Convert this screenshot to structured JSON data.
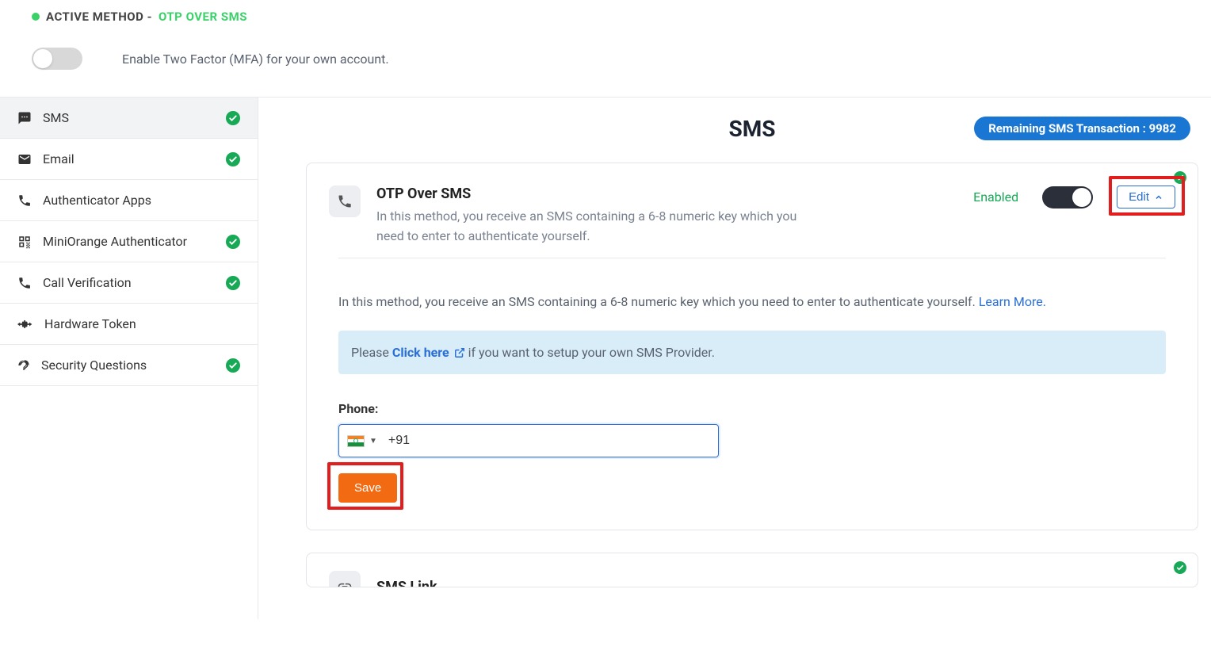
{
  "banner": {
    "activeLabel": "ACTIVE METHOD -",
    "activeValue": "OTP OVER SMS",
    "mfaDesc": "Enable Two Factor (MFA) for your own account."
  },
  "sidebar": {
    "items": [
      {
        "label": "SMS",
        "check": true,
        "active": true,
        "icon": "sms"
      },
      {
        "label": "Email",
        "check": true,
        "active": false,
        "icon": "email"
      },
      {
        "label": "Authenticator Apps",
        "check": false,
        "active": false,
        "icon": "phone"
      },
      {
        "label": "MiniOrange Authenticator",
        "check": true,
        "active": false,
        "icon": "qr"
      },
      {
        "label": "Call Verification",
        "check": true,
        "active": false,
        "icon": "phone"
      },
      {
        "label": "Hardware Token",
        "check": false,
        "active": false,
        "icon": "usb"
      },
      {
        "label": "Security Questions",
        "check": true,
        "active": false,
        "icon": "question"
      }
    ]
  },
  "main": {
    "title": "SMS",
    "remainingLabel": "Remaining SMS Transaction :",
    "remainingValue": "9982",
    "card": {
      "title": "OTP Over SMS",
      "desc": "In this method, you receive an SMS containing a 6-8 numeric key which you need to enter to authenticate yourself.",
      "enabled": "Enabled",
      "editLabel": "Edit",
      "bodyText": "In this method, you receive an SMS containing a 6-8 numeric key which you need to enter to authenticate yourself.",
      "learnMore": "Learn More.",
      "bannerPrefix": "Please",
      "bannerLink": "Click here",
      "bannerSuffix": "if you want to setup your own SMS Provider.",
      "phoneLabel": "Phone:",
      "phoneValue": "+91",
      "saveLabel": "Save"
    },
    "card2": {
      "title": "SMS Link"
    }
  }
}
